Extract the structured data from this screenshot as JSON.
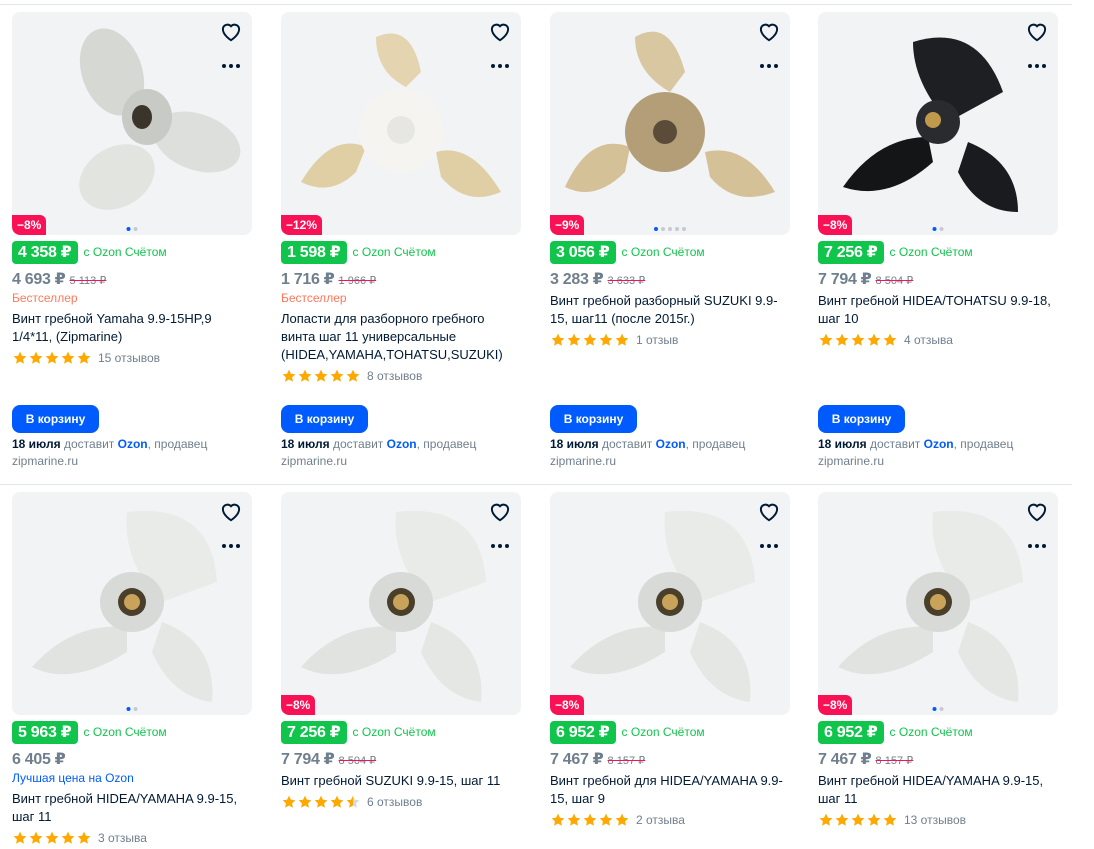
{
  "row1": [
    {
      "discount": "−8%",
      "ozon_price": "4 358 ₽",
      "ozon_label": "с Ozon Счётом",
      "price": "4 693 ₽",
      "old_price": "5 113 ₽",
      "tag": "Бестселлер",
      "title": "Винт гребной Yamaha 9.9-15HP,9 1/4*11, (Zipmarine)",
      "stars": 5,
      "reviews": "15 отзывов",
      "cart_label": "В корзину",
      "delivery_date": "18 июля",
      "delivery_text": "доставит",
      "delivery_service": "Ozon",
      "seller_text": ", продавец zipmarine.ru",
      "image": "propeller-white-three-blade"
    },
    {
      "discount": "−12%",
      "ozon_price": "1 598 ₽",
      "ozon_label": "с Ozon Счётом",
      "price": "1 716 ₽",
      "old_price": "1 966 ₽",
      "tag": "Бестселлер",
      "title": "Лопасти для разборного гребного винта шаг 11 универсальные (HIDEA,YAMAHA,TOHATSU,SUZUKI)",
      "stars": 5,
      "reviews": "8 отзывов",
      "cart_label": "В корзину",
      "delivery_date": "18 июля",
      "delivery_text": "доставит",
      "delivery_service": "Ozon",
      "seller_text": ", продавец zipmarine.ru",
      "image": "propeller-beige-removable-blades"
    },
    {
      "discount": "−9%",
      "ozon_price": "3 056 ₽",
      "ozon_label": "с Ozon Счётом",
      "price": "3 283 ₽",
      "old_price": "3 633 ₽",
      "tag": "",
      "title": "Винт гребной разборный SUZUKI 9.9-15, шаг11 (после 2015г.)",
      "stars": 5,
      "reviews": "1 отзыв",
      "cart_label": "В корзину",
      "delivery_date": "18 июля",
      "delivery_text": "доставит",
      "delivery_service": "Ozon",
      "seller_text": ", продавец zipmarine.ru",
      "image": "propeller-beige-assembled"
    },
    {
      "discount": "−8%",
      "ozon_price": "7 256 ₽",
      "ozon_label": "с Ozon Счётом",
      "price": "7 794 ₽",
      "old_price": "8 504 ₽",
      "tag": "",
      "title": "Винт гребной HIDEA/TOHATSU 9.9-18, шаг 10",
      "stars": 5,
      "reviews": "4 отзыва",
      "cart_label": "В корзину",
      "delivery_date": "18 июля",
      "delivery_text": "доставит",
      "delivery_service": "Ozon",
      "seller_text": ", продавец zipmarine.ru",
      "image": "propeller-black"
    }
  ],
  "row2": [
    {
      "discount": "",
      "ozon_price": "5 963 ₽",
      "ozon_label": "с Ozon Счётом",
      "price": "6 405 ₽",
      "old_price": "",
      "tag_ozon": "Лучшая цена на Ozon",
      "title": "Винт гребной HIDEA/YAMAHA 9.9-15, шаг 11",
      "stars": 5,
      "reviews": "3 отзыва",
      "image": "propeller-white"
    },
    {
      "discount": "−8%",
      "ozon_price": "7 256 ₽",
      "ozon_label": "с Ozon Счётом",
      "price": "7 794 ₽",
      "old_price": "8 504 ₽",
      "tag_ozon": "",
      "title": "Винт гребной SUZUKI 9.9-15, шаг 11",
      "stars": 4.5,
      "reviews": "6 отзывов",
      "image": "propeller-white"
    },
    {
      "discount": "−8%",
      "ozon_price": "6 952 ₽",
      "ozon_label": "с Ozon Счётом",
      "price": "7 467 ₽",
      "old_price": "8 157 ₽",
      "tag_ozon": "",
      "title": "Винт гребной для HIDEA/YAMAHA 9.9-15, шаг 9",
      "stars": 5,
      "reviews": "2 отзыва",
      "image": "propeller-white"
    },
    {
      "discount": "−8%",
      "ozon_price": "6 952 ₽",
      "ozon_label": "с Ozon Счётом",
      "price": "7 467 ₽",
      "old_price": "8 157 ₽",
      "tag_ozon": "",
      "title": "Винт гребной HIDEA/YAMAHA 9.9-15, шаг 11",
      "stars": 5,
      "reviews": "13 отзывов",
      "image": "propeller-white"
    }
  ],
  "colors": {
    "ozon_green": "#10c44c",
    "discount_red": "#f91155",
    "brand_blue": "#005bff",
    "star_yellow": "#ffa800",
    "bestseller_orange": "#ff7859"
  }
}
